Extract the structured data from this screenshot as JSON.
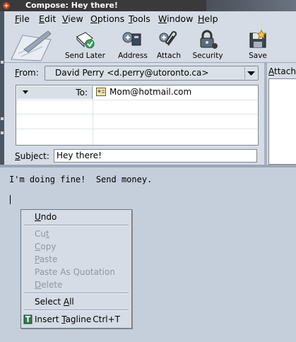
{
  "window": {
    "title": "Compose: Hey there!"
  },
  "menubar": {
    "items": [
      {
        "label": "File",
        "mnemonic": "F",
        "rest": "ile"
      },
      {
        "label": "Edit",
        "mnemonic": "E",
        "rest": "dit"
      },
      {
        "label": "View",
        "mnemonic": "V",
        "rest": "iew"
      },
      {
        "label": "Options",
        "mnemonic": "O",
        "rest": "ptions"
      },
      {
        "label": "Tools",
        "mnemonic": "T",
        "rest": "ools"
      },
      {
        "label": "Window",
        "mnemonic": "W",
        "rest": "indow"
      },
      {
        "label": "Help",
        "mnemonic": "H",
        "rest": "elp"
      }
    ]
  },
  "toolbar": {
    "send_later": {
      "label": "Send Later",
      "icon": "send-later-icon"
    },
    "address": {
      "label": "Address",
      "icon": "address-book-icon"
    },
    "attach": {
      "label": "Attach",
      "icon": "paperclip-icon"
    },
    "security": {
      "label": "Security",
      "icon": "padlock-icon"
    },
    "save": {
      "label": "Save",
      "icon": "floppy-icon"
    }
  },
  "header": {
    "from_label": "From:",
    "from_mnemonic": "F",
    "from_rest": "rom:",
    "from_value": "David Perry <d.perry@utoronto.ca>",
    "recipients": [
      {
        "type": "To:",
        "address": "Mom@hotmail.com"
      }
    ],
    "subject_label": "Subject:",
    "subject_mnemonic": "S",
    "subject_rest": "ubject:",
    "subject_value": "Hey there!",
    "attachments_label": "Attachments:",
    "attachments_mnemonic": "A",
    "attachments_rest": "ttachments:"
  },
  "body": {
    "text": "I'm doing fine!  Send money."
  },
  "context_menu": {
    "items": [
      {
        "label": "Undo",
        "mnemonic": "U",
        "rest": "ndo",
        "enabled": true
      },
      {
        "label": "Cut",
        "pre": "Cu",
        "mnemonic": "t",
        "rest": "",
        "enabled": false
      },
      {
        "label": "Copy",
        "mnemonic": "C",
        "rest": "opy",
        "enabled": false
      },
      {
        "label": "Paste",
        "mnemonic": "P",
        "rest": "aste",
        "enabled": false
      },
      {
        "label": "Paste As Quotation",
        "enabled": false
      },
      {
        "label": "Delete",
        "mnemonic": "D",
        "rest": "elete",
        "enabled": false
      },
      {
        "label": "Select All",
        "pre": "Select ",
        "mnemonic": "A",
        "rest": "ll",
        "enabled": true
      },
      {
        "label": "Insert Tagline",
        "pre": "Insert ",
        "mnemonic": "T",
        "rest": "agline",
        "shortcut": "Ctrl+T",
        "enabled": true,
        "icon": "tagline-icon"
      }
    ]
  },
  "colors": {
    "titlebar": "#3a3a3a",
    "chrome": "#d5dce5",
    "body_bg": "#c4cfdb",
    "disabled_text": "#8e97a3"
  }
}
